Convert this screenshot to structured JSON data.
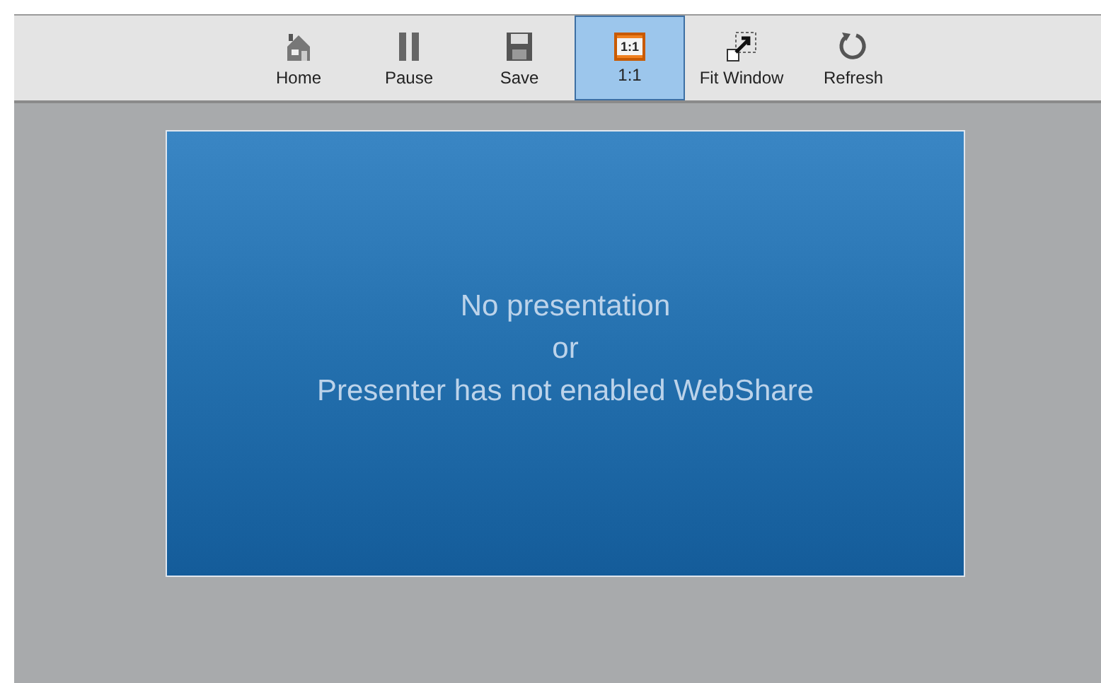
{
  "toolbar": {
    "buttons": [
      {
        "kind": "home",
        "label": "Home",
        "selected": false
      },
      {
        "kind": "pause",
        "label": "Pause",
        "selected": false
      },
      {
        "kind": "save",
        "label": "Save",
        "selected": false
      },
      {
        "kind": "actual-size",
        "label": "1:1",
        "icon_text": "1:1",
        "selected": true
      },
      {
        "kind": "fit",
        "label": "Fit Window",
        "selected": false
      },
      {
        "kind": "refresh",
        "label": "Refresh",
        "selected": false
      }
    ]
  },
  "viewer": {
    "message": [
      "No presentation",
      "or",
      "Presenter has not enabled WebShare"
    ]
  }
}
